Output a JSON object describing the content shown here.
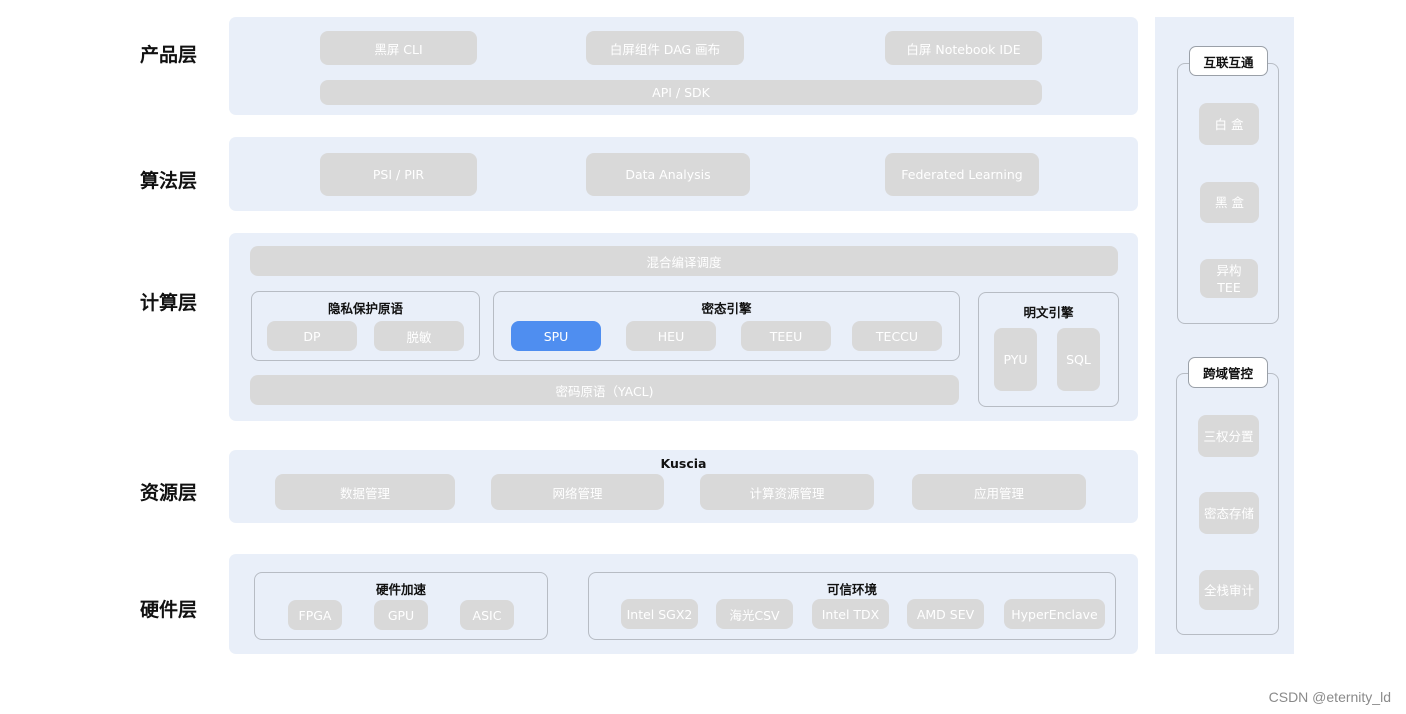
{
  "layers": {
    "product": "产品层",
    "algorithm": "算法层",
    "compute": "计算层",
    "resource": "资源层",
    "hardware": "硬件层"
  },
  "product": {
    "items": [
      "黑屏 CLI",
      "白屏组件 DAG 画布",
      "白屏 Notebook IDE"
    ],
    "api": "API / SDK"
  },
  "algorithm": {
    "items": [
      "PSI / PIR",
      "Data Analysis",
      "Federated Learning"
    ]
  },
  "compute": {
    "scheduler": "混合编译调度",
    "privacy": {
      "title": "隐私保护原语",
      "items": [
        "DP",
        "脱敏"
      ]
    },
    "cipher": {
      "title": "密态引擎",
      "items": [
        "SPU",
        "HEU",
        "TEEU",
        "TECCU"
      ],
      "active": "SPU"
    },
    "plain": {
      "title": "明文引擎",
      "items": [
        "PYU",
        "SQL"
      ]
    },
    "yacl": "密码原语（YACL)"
  },
  "resource": {
    "title": "Kuscia",
    "items": [
      "数据管理",
      "网络管理",
      "计算资源管理",
      "应用管理"
    ]
  },
  "hardware": {
    "accel": {
      "title": "硬件加速",
      "items": [
        "FPGA",
        "GPU",
        "ASIC"
      ]
    },
    "trusted": {
      "title": "可信环境",
      "items": [
        "Intel SGX2",
        "海光CSV",
        "Intel TDX",
        "AMD SEV",
        "HyperEnclave"
      ]
    }
  },
  "side": {
    "interop": {
      "title": "互联互通",
      "items": [
        "白 盒",
        "黑 盒",
        "异构\nTEE"
      ]
    },
    "control": {
      "title": "跨域管控",
      "items": [
        "三权分置",
        "密态存储",
        "全栈审计"
      ]
    }
  },
  "watermark": "CSDN @eternity_ld",
  "colors": {
    "band": "#e9eff9",
    "pill": "#d9d9d9",
    "active": "#4f8ef0"
  }
}
